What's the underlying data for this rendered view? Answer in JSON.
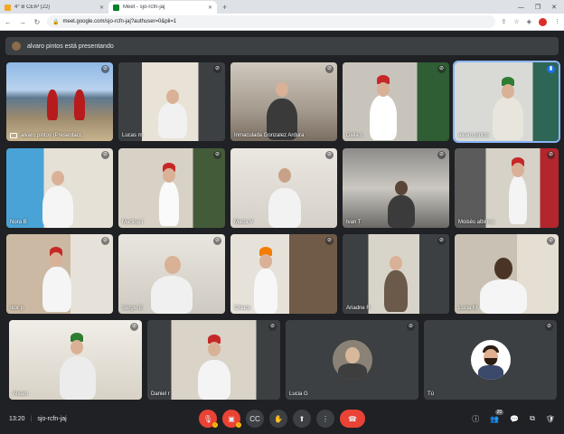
{
  "browser": {
    "tabs": [
      {
        "label": "4° B CEIP (22)",
        "active": false
      },
      {
        "label": "Meet - sjo-rcfn-jaj",
        "active": true
      }
    ],
    "new_tab": "+",
    "window_controls": [
      "—",
      "❐",
      "✕"
    ],
    "url": "meet.google.com/sjo-rcfn-jaj?authuser=0&pli=1"
  },
  "meet": {
    "presenting_banner": "alvaro pintos está presentando",
    "participants": [
      {
        "name": "alvaro pintos (Presentaci...",
        "mic": "muted",
        "presentation": true
      },
      {
        "name": "Lucas m",
        "mic": "muted"
      },
      {
        "name": "Inmaculada Gonzalez Ardura",
        "mic": "muted"
      },
      {
        "name": "Dalia c",
        "mic": "muted"
      },
      {
        "name": "alvaro pintos",
        "mic": "speaking"
      },
      {
        "name": "Nora B",
        "mic": "muted"
      },
      {
        "name": "Martina I",
        "mic": "muted"
      },
      {
        "name": "Marta V",
        "mic": "muted"
      },
      {
        "name": "Ivan T",
        "mic": "muted"
      },
      {
        "name": "Moisés albinno",
        "mic": "muted"
      },
      {
        "name": "Ikor p",
        "mic": "muted"
      },
      {
        "name": "Sergio E",
        "mic": "muted"
      },
      {
        "name": "Chiara",
        "mic": "muted"
      },
      {
        "name": "Ariadne R",
        "mic": "muted"
      },
      {
        "name": "Lucia M",
        "mic": "muted"
      },
      {
        "name": "Alvaro",
        "mic": "muted"
      },
      {
        "name": "Daniel r",
        "mic": "muted"
      },
      {
        "name": "Lucia G",
        "mic": "muted"
      },
      {
        "name": "Tú",
        "mic": "muted"
      }
    ],
    "bottom": {
      "time": "13:20",
      "separator": "|",
      "meeting_code": "sjo-rcfn-jaj",
      "people_count": "20"
    }
  },
  "colors": {
    "meet_bg": "#202124",
    "tile_bg": "#3c4043",
    "danger": "#ea4335",
    "speaking": "#8ab4f8"
  }
}
